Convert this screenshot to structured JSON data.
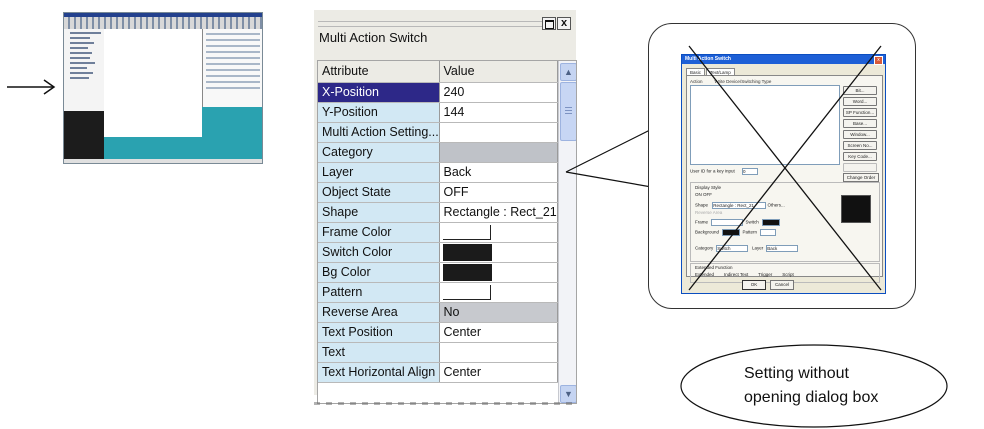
{
  "window": {
    "title": "Multi Action Switch",
    "restore_glyph": "",
    "close_glyph": "x"
  },
  "grid": {
    "headers": {
      "attribute": "Attribute",
      "value": "Value"
    },
    "rows": [
      {
        "attribute": "X-Position",
        "value": "240",
        "kind": "item",
        "selected": true
      },
      {
        "attribute": "Y-Position",
        "value": "144",
        "kind": "item"
      },
      {
        "attribute": "Multi Action Setting...",
        "value": "",
        "kind": "item"
      },
      {
        "attribute": "Category",
        "value": "",
        "kind": "category"
      },
      {
        "attribute": "Layer",
        "value": "Back",
        "kind": "item"
      },
      {
        "attribute": "Object State",
        "value": "OFF",
        "kind": "item"
      },
      {
        "attribute": "Shape",
        "value": "Rectangle : Rect_21",
        "kind": "item"
      },
      {
        "attribute": "Frame Color",
        "value": "",
        "swatch": "#ffffff",
        "kind": "item"
      },
      {
        "attribute": "Switch Color",
        "value": "",
        "swatch": "#1b1b1b",
        "kind": "item"
      },
      {
        "attribute": "Bg Color",
        "value": "",
        "swatch": "#1b1b1b",
        "kind": "item"
      },
      {
        "attribute": "Pattern",
        "value": "",
        "swatch": "#ffffff",
        "kind": "item"
      },
      {
        "attribute": "Reverse Area",
        "value": "No",
        "kind": "item",
        "gray": true
      },
      {
        "attribute": "Text Position",
        "value": "Center",
        "kind": "item"
      },
      {
        "attribute": "Text",
        "value": "",
        "kind": "item"
      },
      {
        "attribute": "Text Horizontal Align",
        "value": "Center",
        "kind": "item"
      }
    ]
  },
  "dialog": {
    "title": "Multi Action Switch",
    "tabs": [
      "Basic",
      "Text/Lamp"
    ],
    "list_headers": [
      "Action",
      "Write Device/Switching Type"
    ],
    "buttons": [
      "Bit...",
      "Word...",
      "SP Function...",
      "Base...",
      "Window...",
      "Screen No...",
      "Key Code...",
      "",
      ""
    ],
    "user_id_label": "User ID for a key input",
    "user_id_value": "0",
    "change_order": "Change Order",
    "display_style": "Display Style",
    "on_off": [
      "ON",
      "OFF"
    ],
    "shape_label": "Shape",
    "shape_value": "Rectangle : Rect_21",
    "others_button": "Others...",
    "reverse_area": "Reverse Area",
    "frame_label": "Frame",
    "switch_label": "Switch",
    "background_label": "Background",
    "pattern_label": "Pattern",
    "category_label": "Category",
    "category_value": "Switch",
    "layer_label": "Layer",
    "layer_value": "Back",
    "extended_function": "Extended Function",
    "extended_checks": [
      "Extended",
      "Indirect Text",
      "Trigger",
      "Script"
    ],
    "ok": "OK",
    "cancel": "Cancel"
  },
  "bubble": {
    "line1": "Setting without",
    "line2": "opening dialog box"
  },
  "colors": {
    "selection": "#2d2888",
    "attribute_bg": "#d2e8f4",
    "category_value_bg": "#bfc2c8",
    "desktop": "#2aa2b0"
  }
}
